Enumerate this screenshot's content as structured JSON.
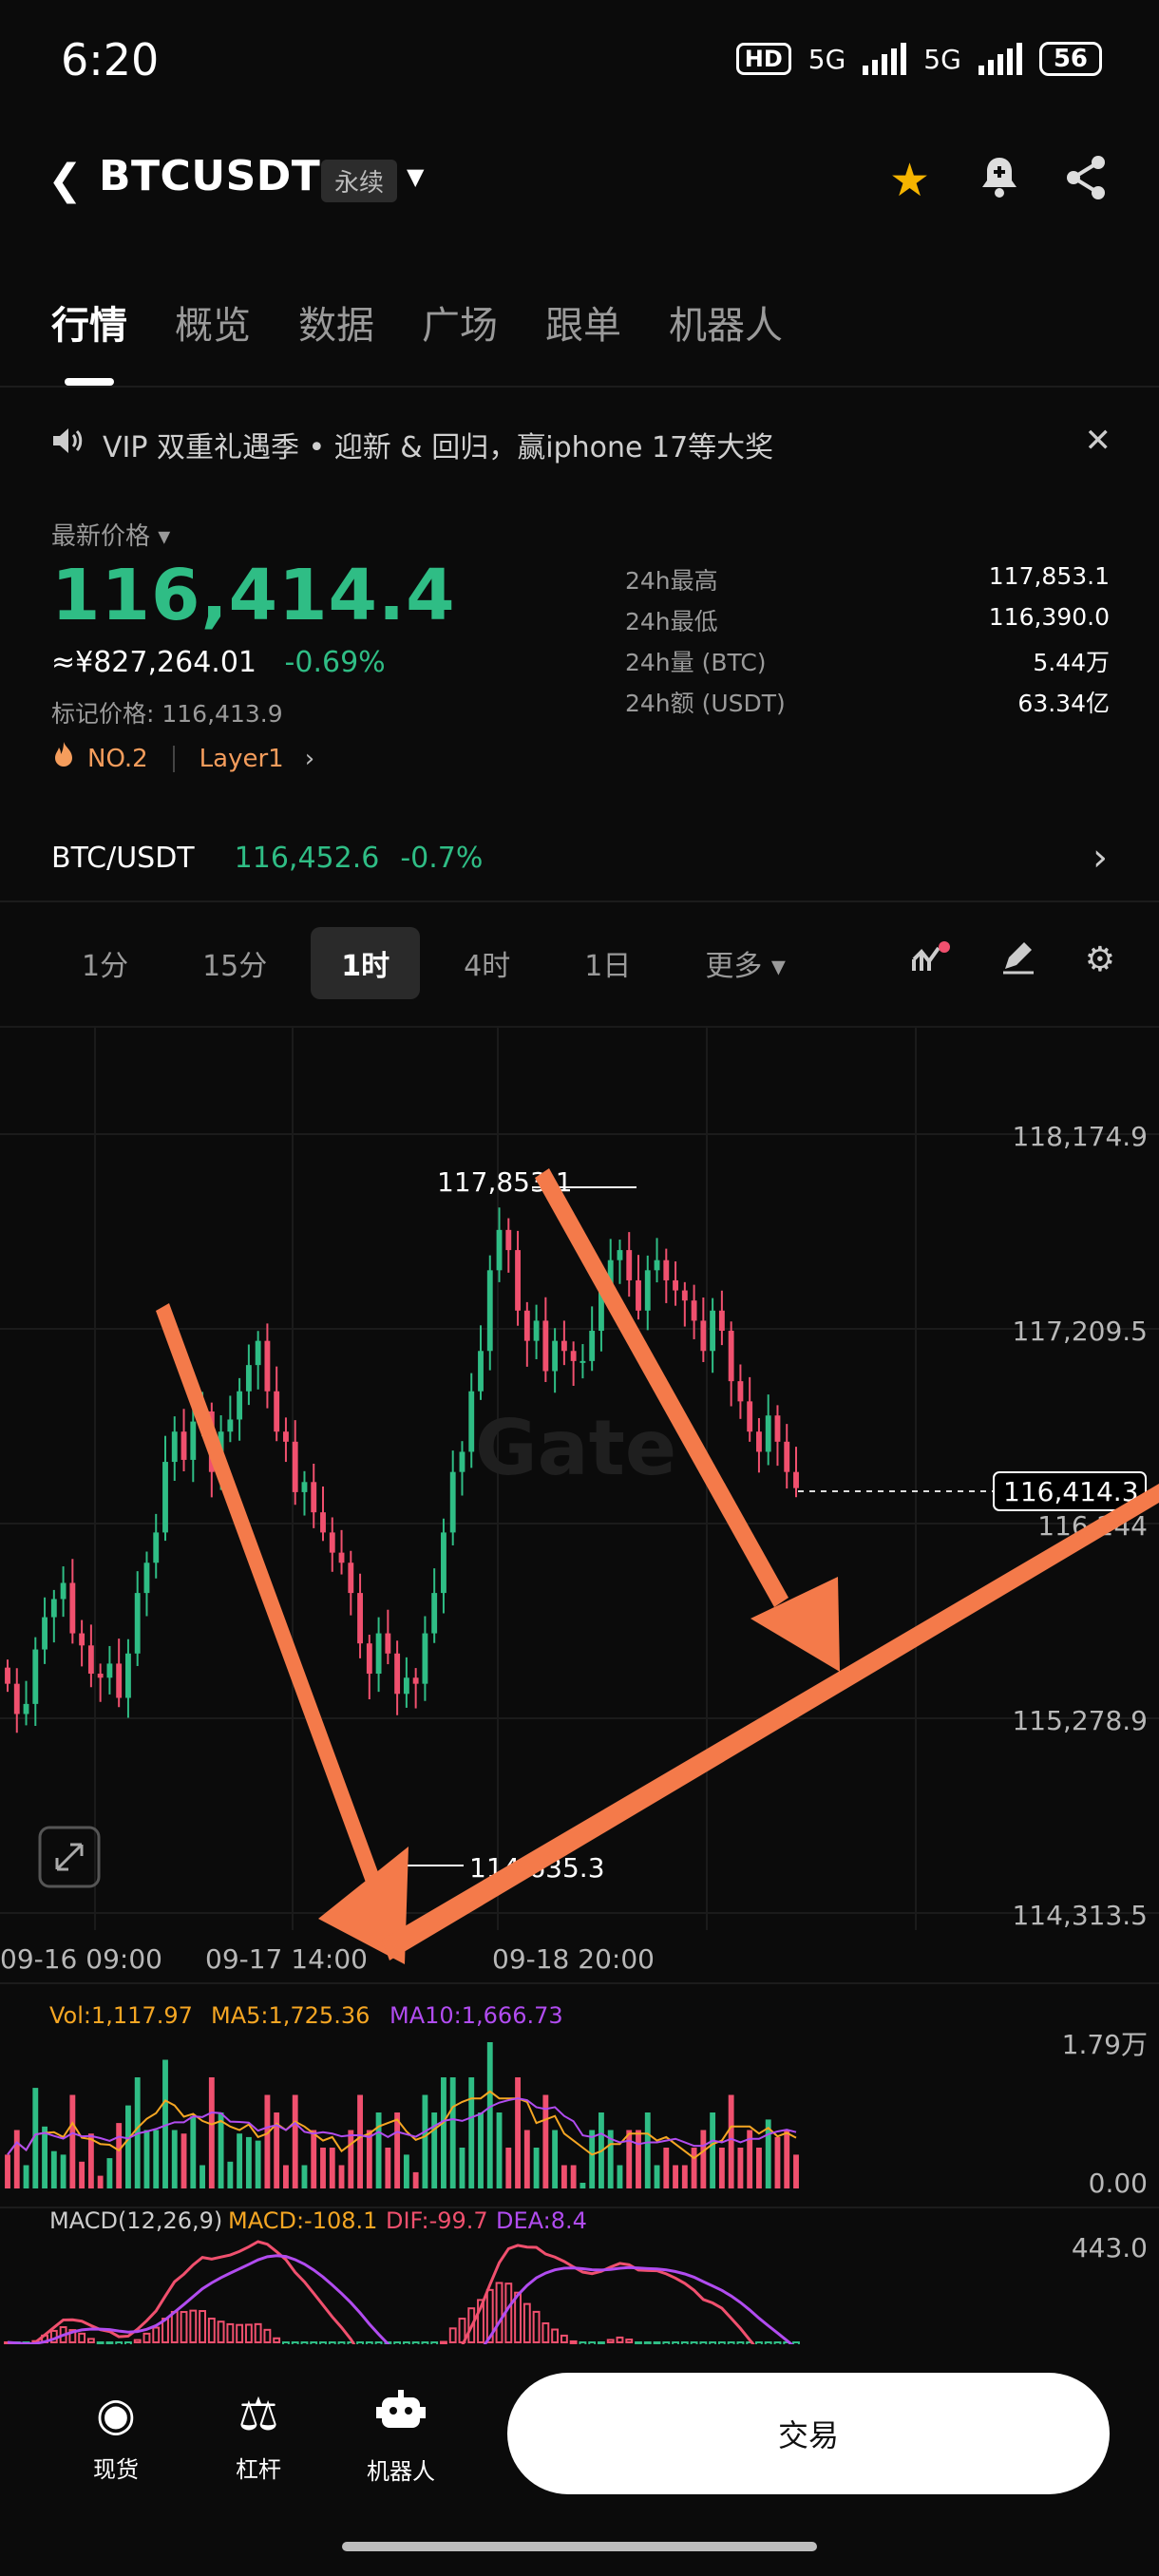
{
  "status_bar": {
    "time": "6:20",
    "hd": "HD",
    "net1": "5G",
    "net2": "5G",
    "battery": "56"
  },
  "header": {
    "symbol": "BTCUSDT",
    "contract": "永续"
  },
  "tabs": [
    {
      "label": "行情"
    },
    {
      "label": "概览"
    },
    {
      "label": "数据"
    },
    {
      "label": "广场"
    },
    {
      "label": "跟单"
    },
    {
      "label": "机器人"
    }
  ],
  "announcement": {
    "text": "VIP 双重礼遇季 • 迎新 & 回归，赢iphone 17等大奖"
  },
  "price": {
    "latest_label": "最新价格",
    "last": "116,414.4",
    "cny": "≈¥827,264.01",
    "change": "-0.69%",
    "mark": "标记价格: 116,413.9",
    "rank": "NO.2",
    "sector": "Layer1"
  },
  "stats": [
    {
      "label": "24h最高",
      "value": "117,853.1"
    },
    {
      "label": "24h最低",
      "value": "116,390.0"
    },
    {
      "label": "24h量 (BTC)",
      "value": "5.44万"
    },
    {
      "label": "24h额 (USDT)",
      "value": "63.34亿"
    }
  ],
  "spot": {
    "pair": "BTC/USDT",
    "price": "116,452.6",
    "change": "-0.7%"
  },
  "intervals": [
    {
      "label": "1分"
    },
    {
      "label": "15分"
    },
    {
      "label": "1时"
    },
    {
      "label": "4时"
    },
    {
      "label": "1日"
    },
    {
      "label": "更多"
    }
  ],
  "chart_data": {
    "type": "candlestick",
    "y_axis_labels": [
      "118,174.9",
      "117,209.5",
      "116,244",
      "115,278.9",
      "114,313.5"
    ],
    "x_axis_labels": [
      "09-16 09:00",
      "09-17 14:00",
      "09-18 20:00"
    ],
    "ylim": [
      114313.5,
      118174.9
    ],
    "high_marker": "117,853.1",
    "low_marker": "114,635.3",
    "current_price_tag": "116,414.3",
    "watermark": "Gate",
    "volume": {
      "vol": "Vol:1,117.97",
      "ma5": "MA5:1,725.36",
      "ma10": "MA10:1,666.73",
      "max": "1.79万",
      "min": "0.00"
    },
    "macd": {
      "params": "MACD(12,26,9)",
      "macd": "MACD:-108.1",
      "dif": "DIF:-99.7",
      "dea": "DEA:8.4",
      "max": "443.0"
    },
    "closes": [
      115450,
      115300,
      115350,
      115620,
      115780,
      115870,
      115950,
      115700,
      115640,
      115500,
      115480,
      115550,
      115380,
      115600,
      115900,
      116050,
      116200,
      116550,
      116700,
      116560,
      116750,
      116800,
      116500,
      116700,
      116760,
      116900,
      117030,
      117150,
      116900,
      116700,
      116650,
      116400,
      116450,
      116300,
      116200,
      116100,
      116050,
      115900,
      115650,
      115500,
      115700,
      115600,
      115400,
      115480,
      115450,
      115700,
      115900,
      116200,
      116500,
      116600,
      116900,
      117100,
      117500,
      117700,
      117600,
      117300,
      117150,
      117250,
      117000,
      117150,
      117100,
      117050,
      117050,
      117200,
      117400,
      117550,
      117600,
      117450,
      117300,
      117500,
      117550,
      117450,
      117400,
      117350,
      117250,
      117100,
      117300,
      117200,
      116950,
      116850,
      116700,
      116600,
      116780,
      116650,
      116500,
      116420
    ],
    "colors": {
      "up": "#2fbd85",
      "down": "#f0506e",
      "ma5": "#f5a623",
      "ma10": "#b14cf0"
    }
  },
  "bottom_nav": [
    {
      "label": "现货"
    },
    {
      "label": "杠杆"
    },
    {
      "label": "机器人"
    }
  ],
  "trade_button": "交易"
}
